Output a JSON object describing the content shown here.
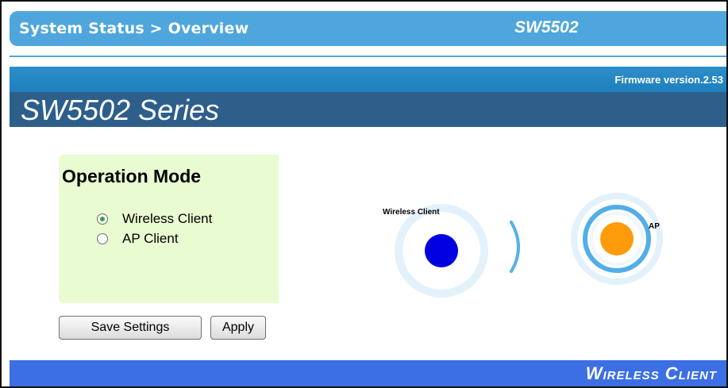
{
  "header": {
    "breadcrumb": "System Status > Overview",
    "model": "SW5502"
  },
  "firmware": {
    "label": "Firmware version.2.53"
  },
  "series": {
    "title": "SW5502 Series"
  },
  "operation_mode": {
    "title": "Operation Mode",
    "options": [
      {
        "label": "Wireless Client",
        "selected": true
      },
      {
        "label": "AP Client",
        "selected": false
      }
    ]
  },
  "buttons": {
    "save_label": "Save Settings",
    "apply_label": "Apply"
  },
  "diagram": {
    "client_label": "Wireless Client",
    "ap_label": "AP"
  },
  "footer": {
    "mode_banner": "Wireless Client"
  },
  "colors": {
    "header_blue": "#4ea6dc",
    "series_navy": "#2e5f8a",
    "panel_green": "#e9fbd0",
    "client_dot": "#0000e0",
    "ap_dot": "#ff9a0a",
    "footer_blue": "#3c6fe3"
  }
}
